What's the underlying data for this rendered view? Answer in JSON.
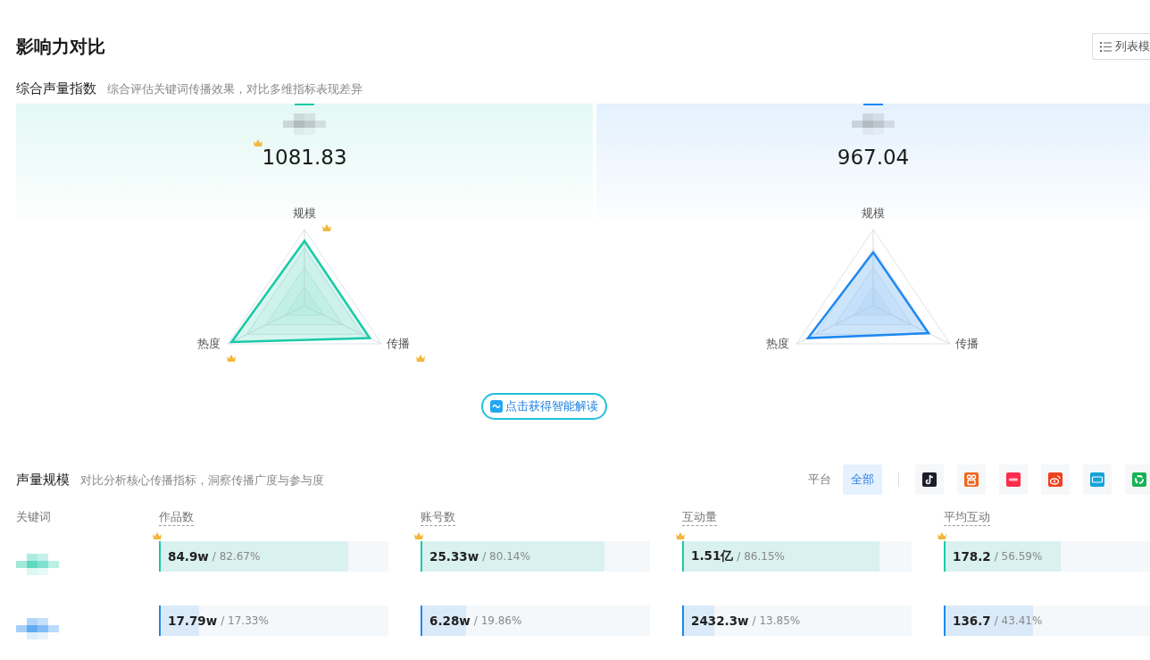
{
  "title": "影响力对比",
  "view_button": {
    "label": "列表模"
  },
  "composite": {
    "title": "综合声量指数",
    "subtitle": "综合评估关键词传播效果，对比多维指标表现差异",
    "keywords": [
      {
        "color": "#19c9a6",
        "score": "1081.83",
        "crown": true,
        "axes": [
          {
            "label": "规模",
            "crown": true
          },
          {
            "label": "热度",
            "crown": true
          },
          {
            "label": "传播",
            "crown": true
          }
        ]
      },
      {
        "color": "#1e88f0",
        "score": "967.04",
        "crown": false,
        "axes": [
          {
            "label": "规模",
            "crown": false
          },
          {
            "label": "热度",
            "crown": false
          },
          {
            "label": "传播",
            "crown": false
          }
        ]
      }
    ]
  },
  "ai_button": {
    "label": "点击获得智能解读"
  },
  "volume": {
    "title": "声量规模",
    "subtitle": "对比分析核心传播指标，洞察传播广度与参与度",
    "platform_label": "平台",
    "platforms": [
      {
        "kind": "all",
        "label": "全部",
        "selected": true
      },
      {
        "kind": "note",
        "selected": false
      },
      {
        "kind": "camera",
        "selected": false
      },
      {
        "kind": "redbook",
        "selected": false
      },
      {
        "kind": "weibo",
        "selected": false
      },
      {
        "kind": "tv",
        "selected": false
      },
      {
        "kind": "ring",
        "selected": false
      }
    ],
    "keyword_header": "关键词",
    "columns": [
      "作品数",
      "账号数",
      "互动量",
      "平均互动"
    ],
    "rows": [
      {
        "color": "#19c9a6",
        "cells": [
          {
            "value": "84.9w",
            "share": "/ 82.67%",
            "level": 0.8267,
            "crown": true
          },
          {
            "value": "25.33w",
            "share": "/ 80.14%",
            "level": 0.8014,
            "crown": true
          },
          {
            "value": "1.51亿",
            "share": "/ 86.15%",
            "level": 0.8615,
            "crown": true
          },
          {
            "value": "178.2",
            "share": "/ 56.59%",
            "level": 0.5659,
            "crown": true
          }
        ]
      },
      {
        "color": "#1e88f0",
        "cells": [
          {
            "value": "17.79w",
            "share": "/ 17.33%",
            "level": 0.1733,
            "crown": false
          },
          {
            "value": "6.28w",
            "share": "/ 19.86%",
            "level": 0.1986,
            "crown": false
          },
          {
            "value": "2432.3w",
            "share": "/ 13.85%",
            "level": 0.1385,
            "crown": false
          },
          {
            "value": "136.7",
            "share": "/ 43.41%",
            "level": 0.4341,
            "crown": false
          }
        ]
      }
    ]
  }
}
